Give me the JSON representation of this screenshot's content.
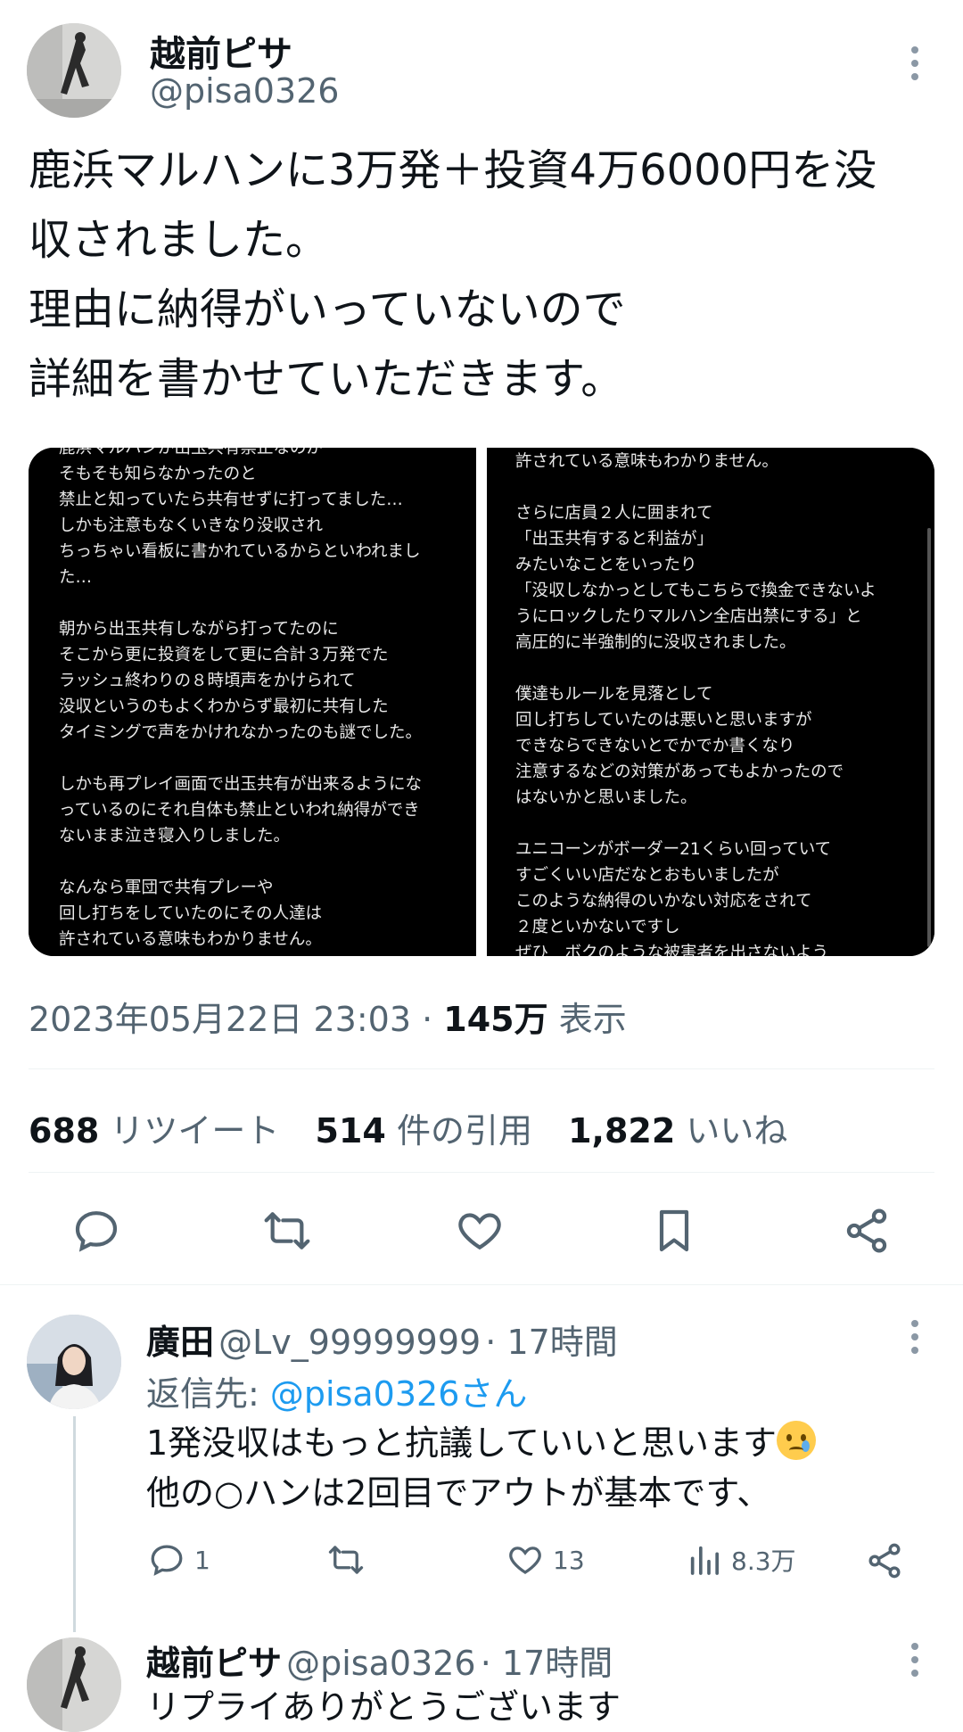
{
  "tweet": {
    "author_name": "越前ピサ",
    "author_handle": "@pisa0326",
    "text_lines": [
      "鹿浜マルハンに3万発＋投資4万6000円を没",
      "収されました。",
      "理由に納得がいっていないので",
      "詳細を書かせていただきます。"
    ],
    "images": [
      {
        "lines": [
          "鹿浜マルハンが出玉共有禁止なのが",
          "そもそも知らなかったのと",
          "禁止と知っていたら共有せずに打ってました…",
          "しかも注意もなくいきなり没収され",
          "ちっちゃい看板に書かれているからといわれまし",
          "た…",
          "",
          "朝から出玉共有しながら打ってたのに",
          "そこから更に投資をして更に合計３万発でた",
          "ラッシュ終わりの８時頃声をかけられて",
          "没収というのもよくわからず最初に共有した",
          "タイミングで声をかけれなかったのも謎でした。",
          "",
          "しかも再プレイ画面で出玉共有が出来るようにな",
          "っているのにそれ自体も禁止といわれ納得ができ",
          "ないまま泣き寝入りしました。",
          "",
          "なんなら軍団で共有プレーや",
          "回し打ちをしていたのにその人達は",
          "許されている意味もわかりません。"
        ]
      },
      {
        "lines": [
          "許されている意味もわかりません。",
          "",
          "さらに店員２人に囲まれて",
          "「出玉共有すると利益が」",
          "みたいなことをいったり",
          "「没収しなかっとしてもこちらで換金できないよ",
          "うにロックしたりマルハン全店出禁にする」と",
          "高圧的に半強制的に没収されました。",
          "",
          "僕達もルールを見落として",
          "回し打ちしていたのは悪いと思いますが",
          "できならできないとでかでか書くなり",
          "注意するなどの対策があってもよかったので",
          "はないかと思いました。",
          "",
          "ユニコーンがボーダー21くらい回っていて",
          "すごくいい店だなとおもいましたが",
          "このような納得のいかない対応をされて",
          "２度といかないですし",
          "ぜひ　ボクのような被害者を出さないよう"
        ]
      }
    ],
    "timestamp": "2023年05月22日 23:03",
    "separator": "·",
    "views_count": "145万",
    "views_label": "表示",
    "retweets_count": "688",
    "retweets_label": "リツイート",
    "quotes_count": "514",
    "quotes_label": "件の引用",
    "likes_count": "1,822",
    "likes_label": "いいね"
  },
  "replies": [
    {
      "name": "廣田",
      "handle": "@Lv_99999999",
      "time": "· 17時間",
      "reply_to_label": "返信先:",
      "reply_to_handle": "@pisa0326さん",
      "line1": "1発没収はもっと抗議していいと思います",
      "line2": "他の○ハンは2回目でアウトが基本です、",
      "reply_count": "1",
      "retweet_count": "",
      "like_count": "13",
      "view_count": "8.3万"
    },
    {
      "name": "越前ピサ",
      "handle": "@pisa0326",
      "time": "· 17時間",
      "line1": "リプライありがとうございます"
    }
  ],
  "colors": {
    "link": "#1d9bf0",
    "secondary_text": "#536471",
    "icon": "#536471"
  },
  "icons": [
    "more-icon",
    "reply-icon",
    "retweet-icon",
    "like-icon",
    "bookmark-icon",
    "share-icon",
    "views-icon",
    "crying-emoji"
  ]
}
